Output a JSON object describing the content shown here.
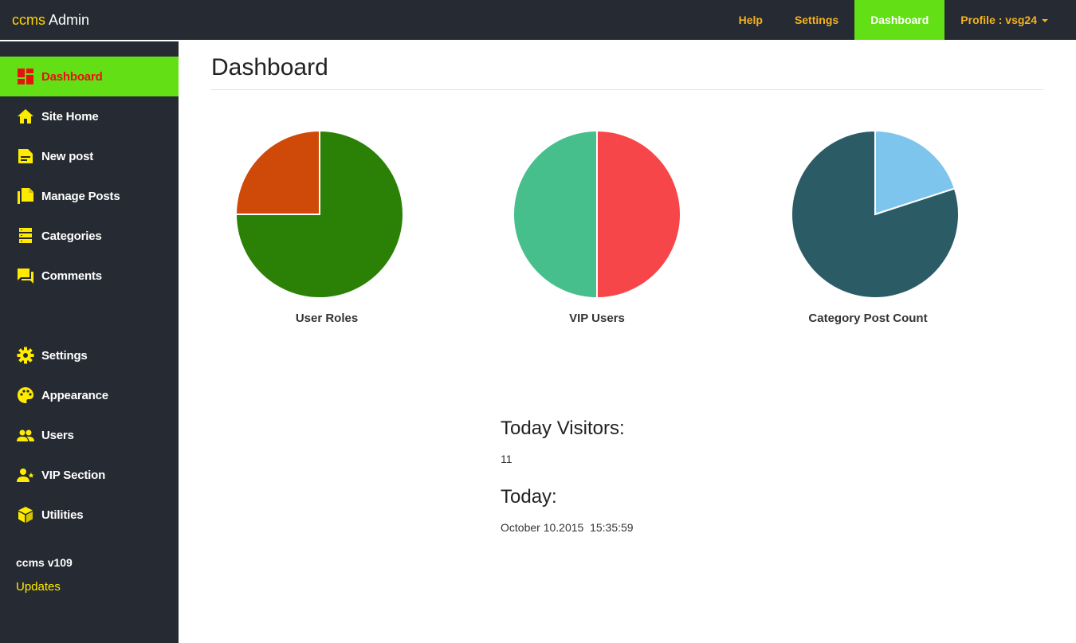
{
  "topbar": {
    "brand_part1": "ccms",
    "brand_part2": " Admin",
    "nav": {
      "help": "Help",
      "settings": "Settings",
      "dashboard": "Dashboard",
      "profile": "Profile : vsg24"
    }
  },
  "sidebar": {
    "items": [
      {
        "label": "Dashboard",
        "icon": "dashboard-icon",
        "active": true
      },
      {
        "label": "Site Home",
        "icon": "home-icon"
      },
      {
        "label": "New post",
        "icon": "new-post-icon"
      },
      {
        "label": "Manage Posts",
        "icon": "manage-posts-icon"
      },
      {
        "label": "Categories",
        "icon": "categories-icon"
      },
      {
        "label": "Comments",
        "icon": "comments-icon"
      },
      {
        "label": "Settings",
        "icon": "gear-icon"
      },
      {
        "label": "Appearance",
        "icon": "palette-icon"
      },
      {
        "label": "Users",
        "icon": "users-icon"
      },
      {
        "label": "VIP Section",
        "icon": "vip-user-icon"
      },
      {
        "label": "Utilities",
        "icon": "cube-icon"
      }
    ],
    "version": "ccms v109",
    "updates": "Updates"
  },
  "main": {
    "title": "Dashboard",
    "visitors_label": "Today Visitors:",
    "visitors_value": "11",
    "today_label": "Today:",
    "today_value": "October 10.2015  15:35:59"
  },
  "chart_data": [
    {
      "type": "pie",
      "title": "User Roles",
      "slices": [
        {
          "value": 75,
          "color": "#2b8106"
        },
        {
          "value": 25,
          "color": "#cf4a08"
        }
      ]
    },
    {
      "type": "pie",
      "title": "VIP Users",
      "slices": [
        {
          "value": 50,
          "color": "#f7464a"
        },
        {
          "value": 50,
          "color": "#46bf8d"
        }
      ]
    },
    {
      "type": "pie",
      "title": "Category Post Count",
      "slices": [
        {
          "value": 20,
          "color": "#7ec5ee"
        },
        {
          "value": 80,
          "color": "#2b5c66"
        }
      ]
    }
  ],
  "colors": {
    "topbar_bg": "#262a33",
    "accent_green": "#62e015",
    "nav_text": "#f5b31b",
    "sidebar_icon": "#ffeb00",
    "active_text": "#e8120c"
  }
}
